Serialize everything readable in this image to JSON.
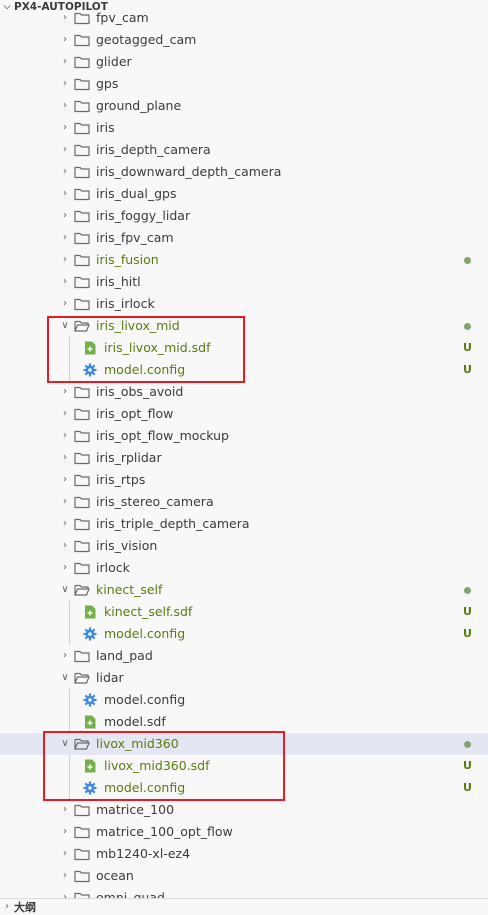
{
  "explorer": {
    "section_title": "PX4-AUTOPILOT",
    "outline_title": "大纲",
    "items": [
      {
        "kind": "folder",
        "label": "fpv_cam",
        "open": false,
        "color": "normal"
      },
      {
        "kind": "folder",
        "label": "geotagged_cam",
        "open": false,
        "color": "normal"
      },
      {
        "kind": "folder",
        "label": "glider",
        "open": false,
        "color": "normal"
      },
      {
        "kind": "folder",
        "label": "gps",
        "open": false,
        "color": "normal"
      },
      {
        "kind": "folder",
        "label": "ground_plane",
        "open": false,
        "color": "normal"
      },
      {
        "kind": "folder",
        "label": "iris",
        "open": false,
        "color": "normal"
      },
      {
        "kind": "folder",
        "label": "iris_depth_camera",
        "open": false,
        "color": "normal"
      },
      {
        "kind": "folder",
        "label": "iris_downward_depth_camera",
        "open": false,
        "color": "normal"
      },
      {
        "kind": "folder",
        "label": "iris_dual_gps",
        "open": false,
        "color": "normal"
      },
      {
        "kind": "folder",
        "label": "iris_foggy_lidar",
        "open": false,
        "color": "normal"
      },
      {
        "kind": "folder",
        "label": "iris_fpv_cam",
        "open": false,
        "color": "normal"
      },
      {
        "kind": "folder",
        "label": "iris_fusion",
        "open": false,
        "color": "green",
        "dot": true
      },
      {
        "kind": "folder",
        "label": "iris_hitl",
        "open": false,
        "color": "normal"
      },
      {
        "kind": "folder",
        "label": "iris_irlock",
        "open": false,
        "color": "normal"
      },
      {
        "kind": "folder",
        "label": "iris_livox_mid",
        "open": true,
        "color": "green",
        "dot": true
      },
      {
        "kind": "file",
        "label": "iris_livox_mid.sdf",
        "icon": "sdf",
        "color": "green",
        "badge": "U"
      },
      {
        "kind": "file",
        "label": "model.config",
        "icon": "gear",
        "color": "green",
        "badge": "U"
      },
      {
        "kind": "folder",
        "label": "iris_obs_avoid",
        "open": false,
        "color": "normal"
      },
      {
        "kind": "folder",
        "label": "iris_opt_flow",
        "open": false,
        "color": "normal"
      },
      {
        "kind": "folder",
        "label": "iris_opt_flow_mockup",
        "open": false,
        "color": "normal"
      },
      {
        "kind": "folder",
        "label": "iris_rplidar",
        "open": false,
        "color": "normal"
      },
      {
        "kind": "folder",
        "label": "iris_rtps",
        "open": false,
        "color": "normal"
      },
      {
        "kind": "folder",
        "label": "iris_stereo_camera",
        "open": false,
        "color": "normal"
      },
      {
        "kind": "folder",
        "label": "iris_triple_depth_camera",
        "open": false,
        "color": "normal"
      },
      {
        "kind": "folder",
        "label": "iris_vision",
        "open": false,
        "color": "normal"
      },
      {
        "kind": "folder",
        "label": "irlock",
        "open": false,
        "color": "normal"
      },
      {
        "kind": "folder",
        "label": "kinect_self",
        "open": true,
        "color": "green",
        "dot": true
      },
      {
        "kind": "file",
        "label": "kinect_self.sdf",
        "icon": "sdf",
        "color": "green",
        "badge": "U"
      },
      {
        "kind": "file",
        "label": "model.config",
        "icon": "gear",
        "color": "green",
        "badge": "U"
      },
      {
        "kind": "folder",
        "label": "land_pad",
        "open": false,
        "color": "normal"
      },
      {
        "kind": "folder",
        "label": "lidar",
        "open": true,
        "color": "normal"
      },
      {
        "kind": "file",
        "label": "model.config",
        "icon": "gear",
        "color": "normal"
      },
      {
        "kind": "file",
        "label": "model.sdf",
        "icon": "sdf",
        "color": "normal"
      },
      {
        "kind": "folder",
        "label": "livox_mid360",
        "open": true,
        "color": "green",
        "dot": true,
        "selected": true
      },
      {
        "kind": "file",
        "label": "livox_mid360.sdf",
        "icon": "sdf",
        "color": "green",
        "badge": "U"
      },
      {
        "kind": "file",
        "label": "model.config",
        "icon": "gear",
        "color": "green",
        "badge": "U"
      },
      {
        "kind": "folder",
        "label": "matrice_100",
        "open": false,
        "color": "normal"
      },
      {
        "kind": "folder",
        "label": "matrice_100_opt_flow",
        "open": false,
        "color": "normal"
      },
      {
        "kind": "folder",
        "label": "mb1240-xl-ez4",
        "open": false,
        "color": "normal"
      },
      {
        "kind": "folder",
        "label": "ocean",
        "open": false,
        "color": "normal"
      },
      {
        "kind": "folder",
        "label": "omni_quad",
        "open": false,
        "color": "normal"
      }
    ]
  },
  "colors": {
    "git_untracked": "#587c0c",
    "highlight_box": "#e51c23",
    "folder_icon": "#6c6c6c",
    "gear_icon": "#3b88e0",
    "sdf_icon": "#73b04a"
  }
}
